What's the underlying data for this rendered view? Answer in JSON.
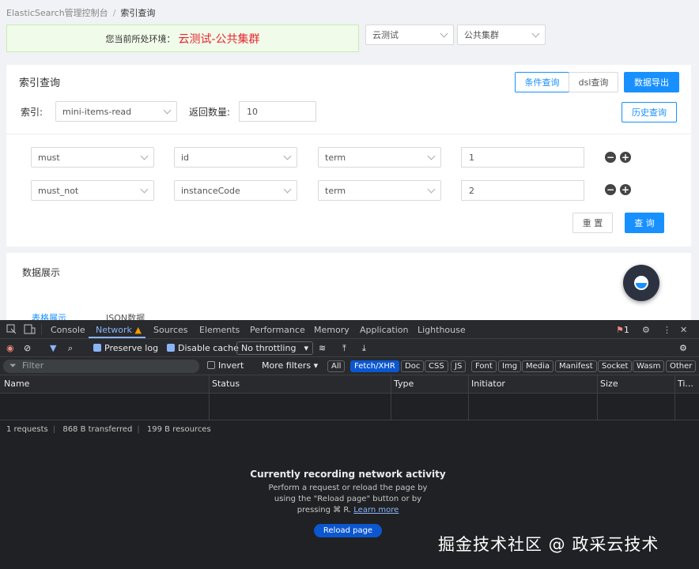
{
  "breadcrumb": {
    "root": "ElasticSearch管理控制台",
    "sep": "/",
    "current": "索引查询"
  },
  "env": {
    "label": "您当前所处环境：",
    "value": "云测试-公共集群"
  },
  "env_selects": [
    "云测试",
    "公共集群"
  ],
  "query_panel": {
    "title": "索引查询",
    "mode_buttons": [
      "条件查询",
      "dsl查询"
    ],
    "export_button": "数据导出",
    "index_label": "索引:",
    "index_value": "mini-items-read",
    "count_label": "返回数量:",
    "count_value": "10",
    "history_button": "历史查询",
    "conditions": [
      {
        "clause": "must",
        "field": "id",
        "op": "term",
        "value": "1"
      },
      {
        "clause": "must_not",
        "field": "instanceCode",
        "op": "term",
        "value": "2"
      }
    ],
    "reset_button": "重 置",
    "search_button": "查 询"
  },
  "data_panel": {
    "title": "数据展示",
    "tabs": [
      "表格展示",
      "JSON数据"
    ]
  },
  "devtools": {
    "tabs": [
      "Console",
      "Network",
      "Sources",
      "Elements",
      "Performance",
      "Memory",
      "Application",
      "Lighthouse"
    ],
    "active_tab": "Network",
    "issues_count": "1",
    "preserve_log": "Preserve log",
    "disable_cache": "Disable cache",
    "throttling": "No throttling",
    "filter_placeholder": "Filter",
    "invert": "Invert",
    "more_filters": "More filters",
    "filter_chips": [
      "All",
      "Fetch/XHR",
      "Doc",
      "CSS",
      "JS",
      "Font",
      "Img",
      "Media",
      "Manifest",
      "Socket",
      "Wasm",
      "Other"
    ],
    "active_chip": "Fetch/XHR",
    "columns": [
      "Name",
      "Status",
      "Type",
      "Initiator",
      "Size",
      "Ti..."
    ],
    "summary": {
      "requests": "1 requests",
      "transferred": "868 B transferred",
      "resources": "199 B resources"
    },
    "empty_title": "Currently recording network activity",
    "empty_text_1": "Perform a request or reload the page by",
    "empty_text_2": "using the \"Reload page\" button or by",
    "empty_text_3": "pressing ⌘ R.",
    "learn_more": "Learn more",
    "reload_button": "Reload page"
  },
  "watermark": "掘金技术社区 @ 政采云技术",
  "colors": {
    "primary": "#1890ff",
    "env_red": "#e8242d",
    "devtools_bg": "#202124",
    "devtools_accent": "#8ab4f8"
  }
}
